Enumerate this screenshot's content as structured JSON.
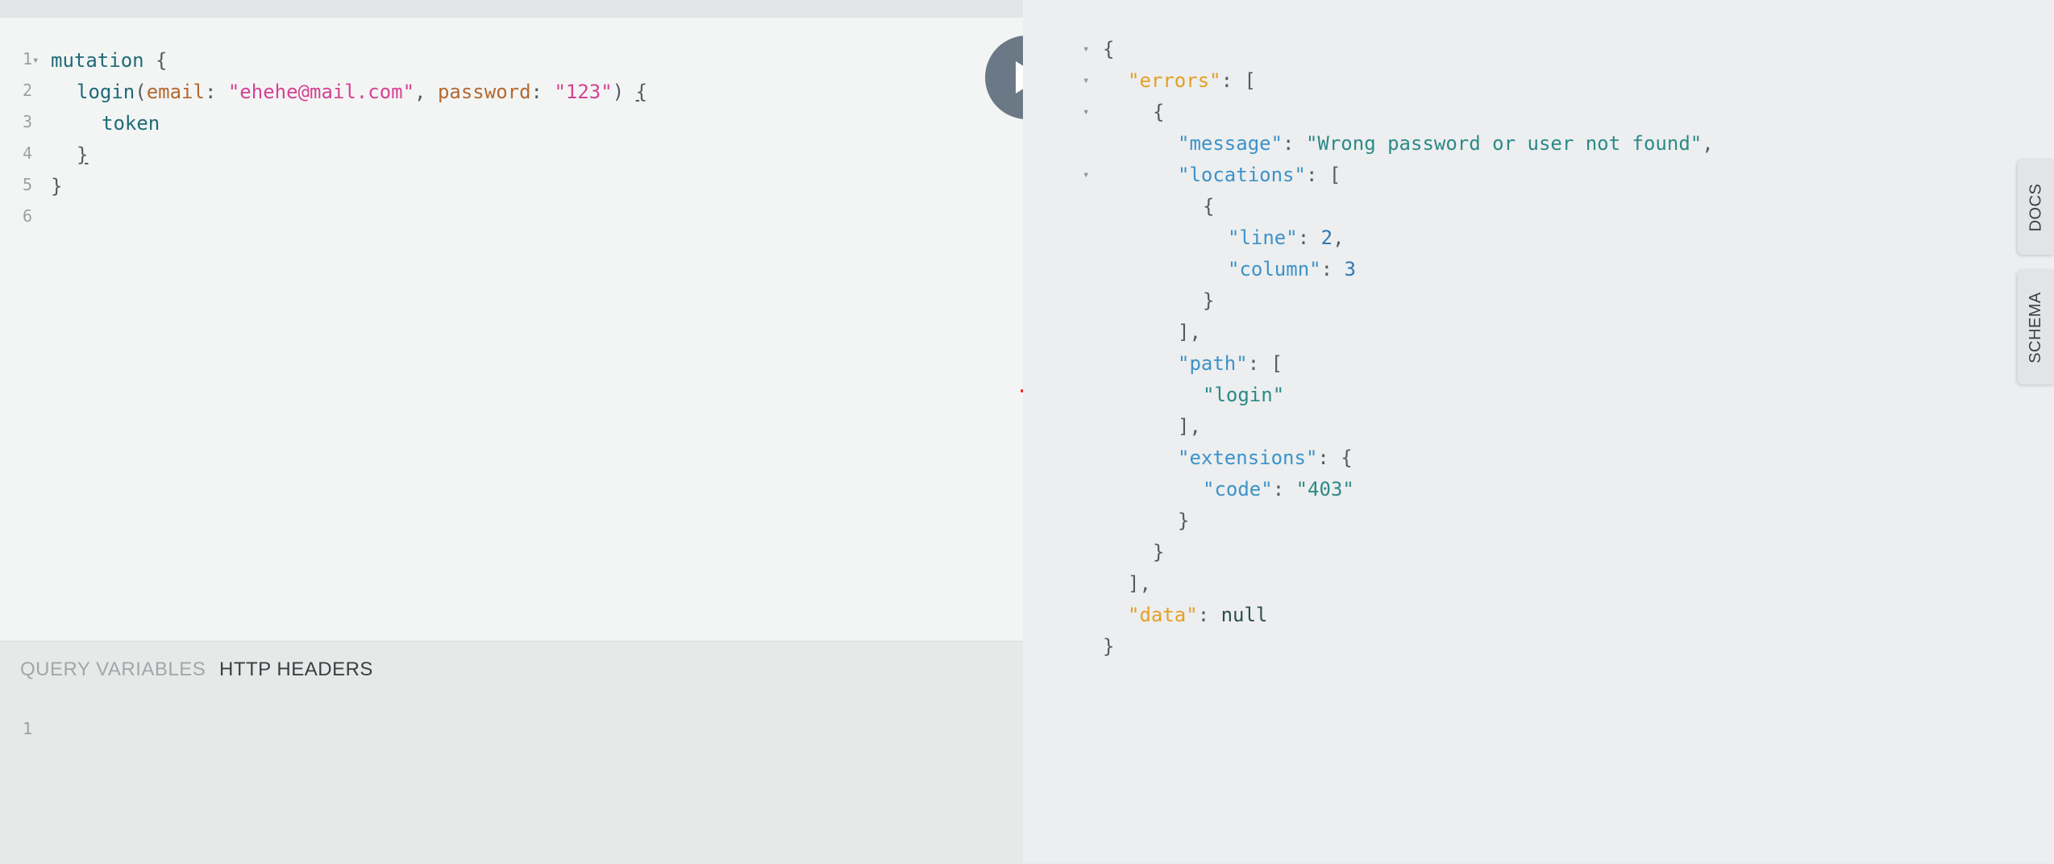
{
  "editor": {
    "line_numbers": [
      "1",
      "2",
      "3",
      "4",
      "5",
      "6"
    ],
    "fold_marker": "▾",
    "tokens": {
      "mutation": "mutation",
      "open_brace": " {",
      "login": "login",
      "paren_open": "(",
      "email": "email",
      "colon1": ": ",
      "email_value": "\"ehehe@mail.com\"",
      "comma": ", ",
      "password": "password",
      "colon2": ": ",
      "password_value": "\"123\"",
      "paren_close": ") ",
      "inner_open": "{",
      "token": "token",
      "inner_close": "}",
      "outer_close": "}"
    }
  },
  "run_button": {
    "icon": "play-icon"
  },
  "bottom_tabs": {
    "query_variables": "QUERY VARIABLES",
    "http_headers": "HTTP HEADERS",
    "line_number": "1"
  },
  "result": {
    "open_brace": "{",
    "errors_key": "\"errors\"",
    "message_key": "\"message\"",
    "message_value": "\"Wrong password or user not found\"",
    "locations_key": "\"locations\"",
    "line_key": "\"line\"",
    "line_value": "2",
    "column_key": "\"column\"",
    "column_value": "3",
    "path_key": "\"path\"",
    "path_value": "\"login\"",
    "extensions_key": "\"extensions\"",
    "code_key": "\"code\"",
    "code_value": "\"403\"",
    "data_key": "\"data\"",
    "data_value": "null",
    "fold_marker": "▾"
  },
  "side_tabs": {
    "docs": "DOCS",
    "schema": "SCHEMA"
  },
  "colors": {
    "run_button": "#6b7885",
    "keyword": "#1f6b76",
    "argument": "#b5682e",
    "string": "#d64292",
    "result_key": "#3c93c9",
    "result_top_key": "#e5a024",
    "result_string": "#2d8a87",
    "result_number": "#2f77b5"
  }
}
